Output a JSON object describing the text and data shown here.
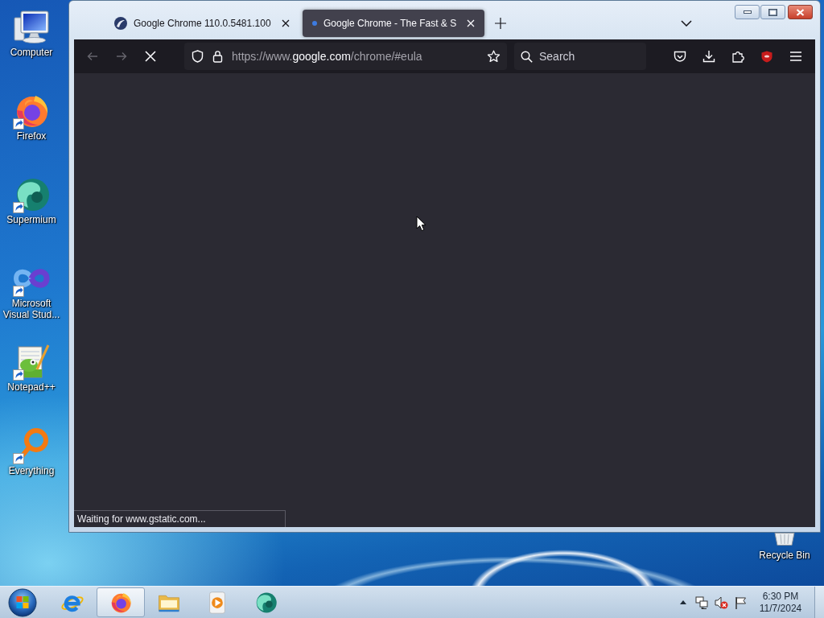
{
  "desktop": {
    "icons": [
      {
        "label": "Computer",
        "kind": "computer",
        "shortcut": false
      },
      {
        "label": "Firefox",
        "kind": "firefox",
        "shortcut": true
      },
      {
        "label": "Supermium",
        "kind": "supermium",
        "shortcut": true
      },
      {
        "label": "Microsoft Visual Stud...",
        "kind": "infinity",
        "shortcut": true
      },
      {
        "label": "Notepad++",
        "kind": "notepad",
        "shortcut": true
      },
      {
        "label": "Everything",
        "kind": "magnifier",
        "shortcut": true
      }
    ],
    "recycle_bin": {
      "label": "Recycle Bin"
    }
  },
  "browser": {
    "tabs": [
      {
        "title": "Google Chrome 110.0.5481.100",
        "selected": false,
        "loading": false
      },
      {
        "title": "Google Chrome - The Fast & S",
        "selected": true,
        "loading": true
      }
    ],
    "toolbar": {
      "back_disabled": true,
      "forward_disabled": true,
      "loading": true,
      "url_parts": [
        {
          "text": "https://www.",
          "highlight": false
        },
        {
          "text": "google.com",
          "highlight": true
        },
        {
          "text": "/chrome/#eula",
          "highlight": false
        }
      ],
      "search": {
        "placeholder": "Search"
      }
    },
    "status": "Waiting for www.gstatic.com..."
  },
  "taskbar": {
    "items": [
      {
        "kind": "ie",
        "selected": false
      },
      {
        "kind": "firefox",
        "selected": true
      },
      {
        "kind": "explorer",
        "selected": false
      },
      {
        "kind": "media",
        "selected": false
      },
      {
        "kind": "supermium",
        "selected": false
      }
    ],
    "tray": {
      "volume_muted": true,
      "time": "6:30 PM",
      "date": "11/7/2024"
    }
  }
}
